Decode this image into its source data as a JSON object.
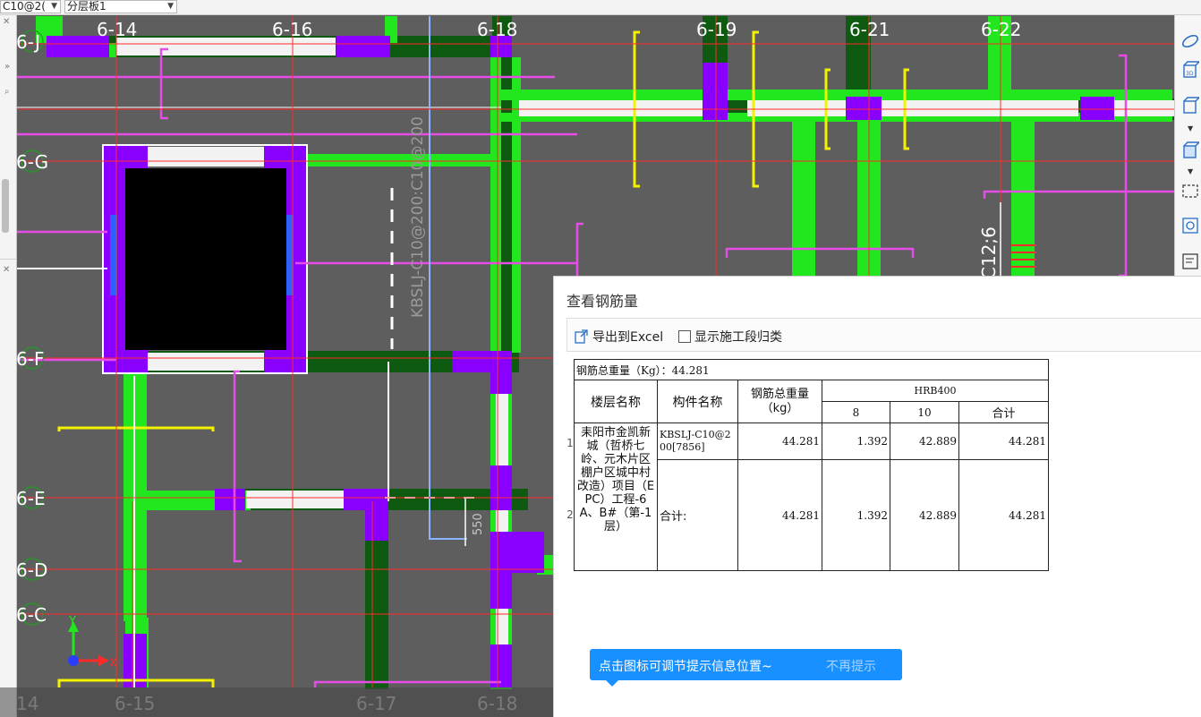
{
  "top_toolbar": {
    "combo_left": "C10@2(",
    "combo_right": "分层板1"
  },
  "cad": {
    "axis_labels_top": [
      "6-14",
      "6-16",
      "6-18",
      "6-19",
      "6-21",
      "6-22"
    ],
    "axis_labels_left": [
      "6-J",
      "6-G",
      "6-F",
      "6-E",
      "6-D",
      "6-C"
    ],
    "axis_labels_bottom": [
      "14",
      "6-15",
      "6-17",
      "6-18"
    ],
    "vertical_member_label": "KBSLJ-C10@200:C10@200",
    "dimension_label": "550",
    "right_member_label": "C12;6",
    "ucs_x": "X",
    "ucs_y": "Y"
  },
  "right_toolbar": {
    "icons": [
      "orbit-icon",
      "3d-view-icon",
      "box-view-icon",
      "solid-view-icon",
      "select-region-icon",
      "component-icon",
      "properties-icon"
    ]
  },
  "dialog": {
    "title": "查看钢筋量",
    "export_label": "导出到Excel",
    "show_seg_label": "显示施工段归类",
    "total_weight_text": "钢筋总重量（Kg）：44.281",
    "headers": {
      "floor": "楼层名称",
      "component": "构件名称",
      "total": "钢筋总重量（kg）",
      "grade": "HRB400",
      "d8": "8",
      "d10": "10",
      "sum": "合计"
    },
    "floor_name": "耒阳市金凯新城（哲桥七岭、元木片区棚户区城中村改造）项目（EPC）工程-6A、B#（第-1层）",
    "rows": [
      {
        "num": "1",
        "component": "KBSLJ-C10@200[7856]",
        "total": "44.281",
        "d8": "1.392",
        "d10": "42.889",
        "sum": "44.281"
      },
      {
        "num": "2",
        "component": "合计:",
        "total": "44.281",
        "d8": "1.392",
        "d10": "42.889",
        "sum": "44.281"
      }
    ]
  },
  "tip": {
    "text": "点击图标可调节提示信息位置~",
    "dismiss": "不再提示"
  },
  "colors": {
    "bg": "#5e5e5e",
    "beam_green": "#22e61e",
    "dark_green": "#0d5a10",
    "purple": "#8a00ff",
    "white": "#ffffff",
    "magenta": "#e64ce6",
    "yellow": "#f3f200",
    "red": "#ff2b2b",
    "blue": "#8ab4ff",
    "tip_blue": "#1990ff"
  }
}
